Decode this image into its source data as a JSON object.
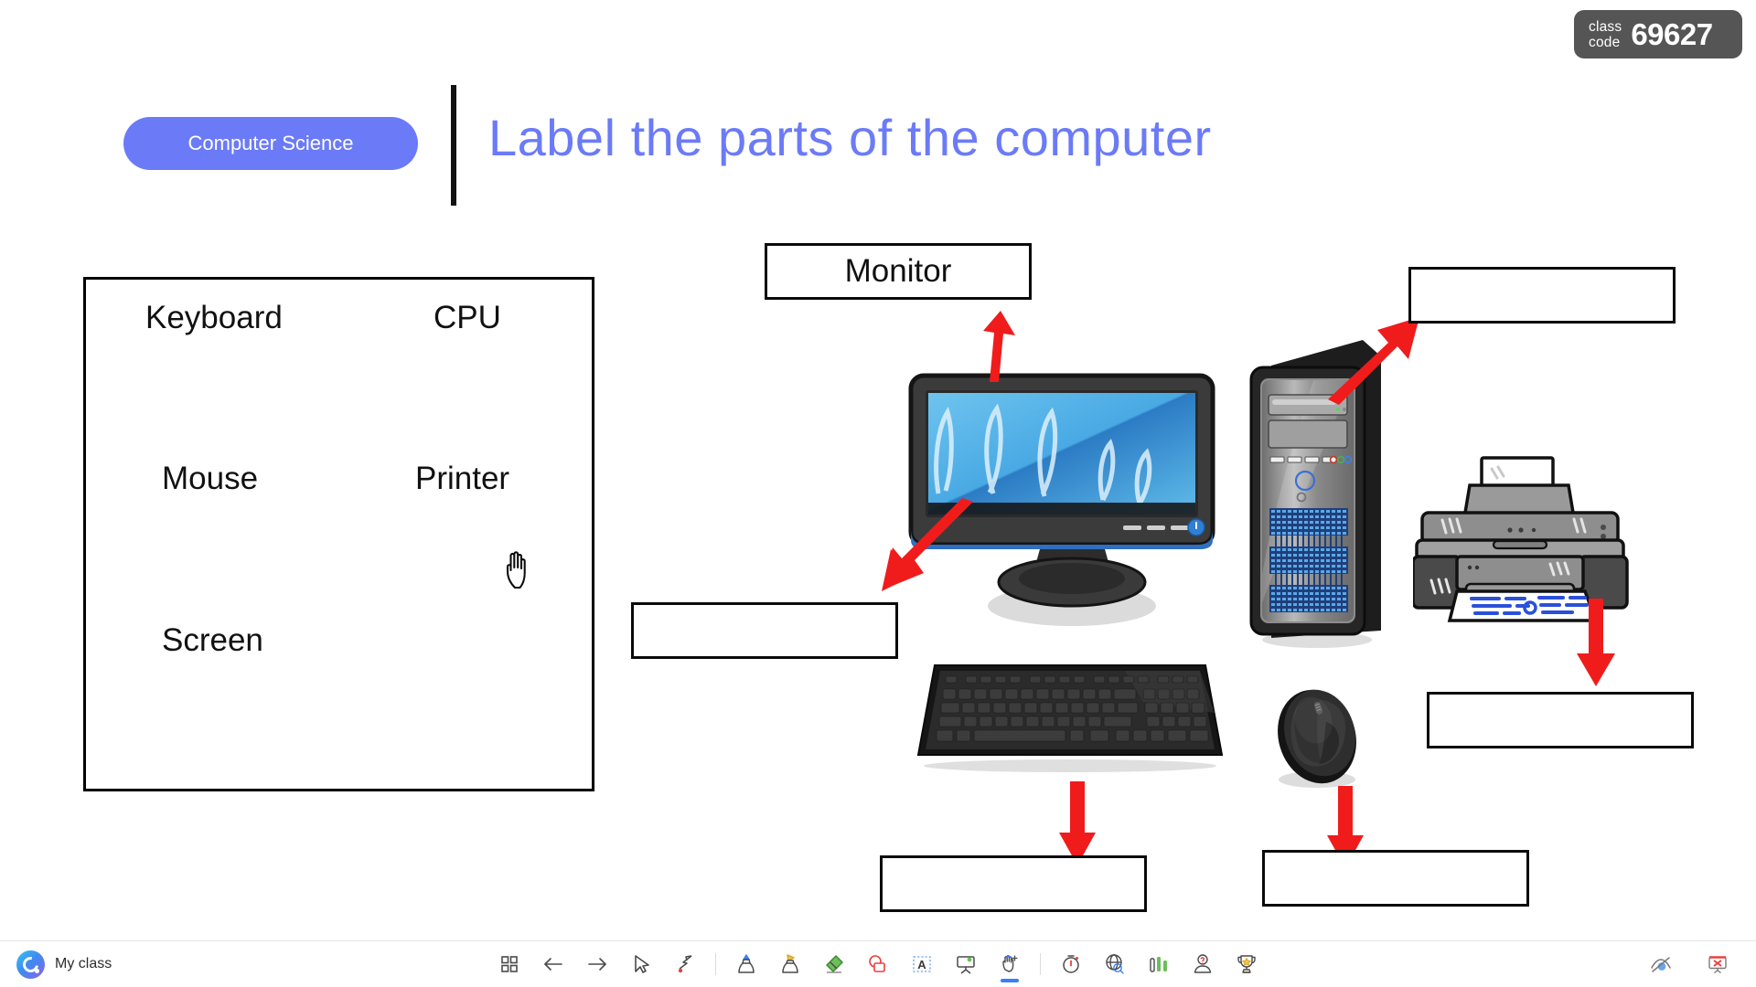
{
  "class_code": {
    "label_line1": "class",
    "label_line2": "code",
    "value": "69627"
  },
  "header": {
    "subject_pill": "Computer Science",
    "title": "Label the parts of the computer",
    "accent_color": "#6B7BF7"
  },
  "word_bank": {
    "words": [
      "Keyboard",
      "CPU",
      "Mouse",
      "Printer",
      "Screen"
    ]
  },
  "answer_boxes": [
    {
      "id": "monitor-label",
      "text": "Monitor",
      "filled": true
    },
    {
      "id": "cpu-label",
      "text": "",
      "filled": false
    },
    {
      "id": "screen-label",
      "text": "",
      "filled": false
    },
    {
      "id": "printer-label",
      "text": "",
      "filled": false
    },
    {
      "id": "keyboard-label",
      "text": "",
      "filled": false
    },
    {
      "id": "mouse-label",
      "text": "",
      "filled": false
    }
  ],
  "arrow_color": "#F01C1C",
  "toolbar": {
    "brand_label": "My class",
    "tools": [
      {
        "name": "grid-view-icon",
        "title": "Grid view"
      },
      {
        "name": "arrow-left-icon",
        "title": "Previous"
      },
      {
        "name": "arrow-right-icon",
        "title": "Next"
      },
      {
        "name": "cursor-icon",
        "title": "Select"
      },
      {
        "name": "laser-pointer-icon",
        "title": "Laser pointer"
      },
      {
        "name": "pen-icon",
        "title": "Pen"
      },
      {
        "name": "highlighter-icon",
        "title": "Highlighter"
      },
      {
        "name": "eraser-icon",
        "title": "Eraser"
      },
      {
        "name": "shapes-icon",
        "title": "Shapes"
      },
      {
        "name": "text-box-icon",
        "title": "Text box"
      },
      {
        "name": "whiteboard-icon",
        "title": "Whiteboard"
      },
      {
        "name": "drag-hand-icon",
        "title": "Drag"
      },
      {
        "name": "timer-icon",
        "title": "Timer"
      },
      {
        "name": "browser-icon",
        "title": "Web"
      },
      {
        "name": "poll-icon",
        "title": "Poll"
      },
      {
        "name": "quiz-icon",
        "title": "Quiz"
      },
      {
        "name": "trophy-icon",
        "title": "Leaderboard"
      }
    ],
    "right_tools": [
      {
        "name": "eye-off-icon",
        "title": "Hide from students"
      },
      {
        "name": "stop-presentation-icon",
        "title": "Stop presenting"
      }
    ]
  },
  "illustration": {
    "items": [
      "monitor",
      "cpu-tower",
      "printer",
      "keyboard",
      "mouse"
    ]
  }
}
